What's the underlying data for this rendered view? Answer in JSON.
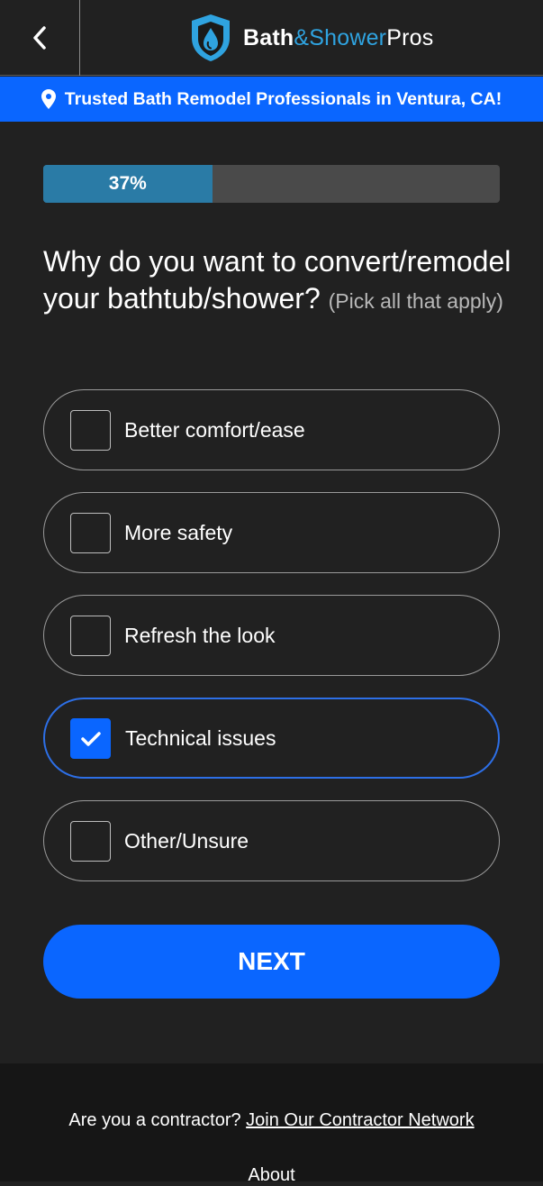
{
  "header": {
    "logo": {
      "part1": "Bath",
      "part2": "&Shower",
      "part3": "Pros"
    }
  },
  "banner": {
    "text": "Trusted Bath Remodel Professionals in Ventura, CA!"
  },
  "progress": {
    "value": 0.37,
    "label": "37%"
  },
  "question": {
    "text": "Why do you want to convert/remodel your bathtub/shower?",
    "hint": "(Pick all that apply)"
  },
  "options": [
    {
      "label": "Better comfort/ease",
      "checked": false
    },
    {
      "label": "More safety",
      "checked": false
    },
    {
      "label": "Refresh the look",
      "checked": false
    },
    {
      "label": "Technical issues",
      "checked": true
    },
    {
      "label": "Other/Unsure",
      "checked": false
    }
  ],
  "next_button": {
    "label": "NEXT"
  },
  "footer": {
    "contractor_text": "Are you a contractor?",
    "contractor_link": "Join Our Contractor Network",
    "about_link": "About"
  },
  "colors": {
    "background": "#212121",
    "accent_blue": "#0a66ff",
    "progress_fill": "#2a7ba6",
    "logo_blue": "#2fa3e0"
  }
}
